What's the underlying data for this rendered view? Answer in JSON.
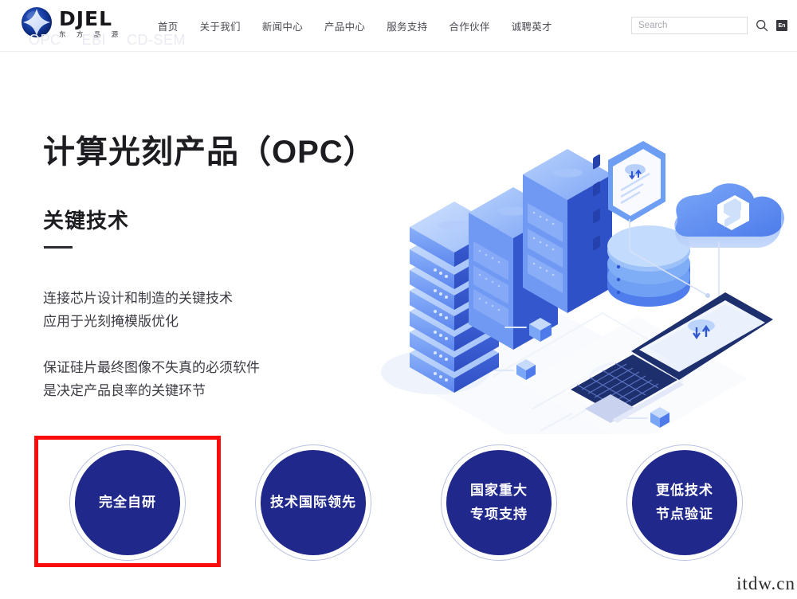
{
  "header": {
    "logo": {
      "wordmark": "DJEL",
      "chinese_name": "东 方 晶 源",
      "mark_icon": "globe-sphere-icon"
    },
    "subnav_items": [
      "OPC",
      "EBI",
      "CD-SEM"
    ],
    "nav_items": [
      {
        "label": "首页",
        "name": "nav-home"
      },
      {
        "label": "关于我们",
        "name": "nav-about"
      },
      {
        "label": "新闻中心",
        "name": "nav-news"
      },
      {
        "label": "产品中心",
        "name": "nav-products"
      },
      {
        "label": "服务支持",
        "name": "nav-support"
      },
      {
        "label": "合作伙伴",
        "name": "nav-partners"
      },
      {
        "label": "诚聘英才",
        "name": "nav-careers"
      }
    ],
    "search": {
      "value": "",
      "placeholder": "Search",
      "icon": "search-icon"
    },
    "language_button": {
      "label": "En",
      "icon": "language-icon"
    }
  },
  "hero": {
    "title": "计算光刻产品（OPC）",
    "subtitle": "关键技术",
    "paragraph1_line1": "连接芯片设计和制造的关键技术",
    "paragraph1_line2": "应用于光刻掩模版优化",
    "paragraph2_line1": "保证硅片最终图像不失真的必须软件",
    "paragraph2_line2": "是决定产品良率的关键环节"
  },
  "features": [
    {
      "name": "feature-self-developed",
      "lines": [
        "完全自研"
      ],
      "highlighted": true
    },
    {
      "name": "feature-world-leading",
      "lines": [
        "技术国际领先"
      ],
      "highlighted": false
    },
    {
      "name": "feature-national-support",
      "lines": [
        "国家重大",
        "专项支持"
      ],
      "highlighted": false
    },
    {
      "name": "feature-lower-node",
      "lines": [
        "更低技术",
        "节点验证"
      ],
      "highlighted": false
    }
  ],
  "illustration": {
    "name": "isometric-datacenter-illustration",
    "elements": [
      "server-stack",
      "server-rack",
      "server-rack-tall",
      "database-cylinder",
      "cloud-storage-icon",
      "tablet-device",
      "laptop-device"
    ]
  },
  "watermark": "itdw.cn",
  "colors": {
    "circle_fill": "#20288c",
    "circle_ring": "#b9c0e2",
    "highlight_box": "#fc0d0d",
    "text_dark": "#1d1d21",
    "text_body": "#3c3c44",
    "illustration_blue": "#5b8ef4",
    "illustration_light": "#a8c6fb"
  }
}
